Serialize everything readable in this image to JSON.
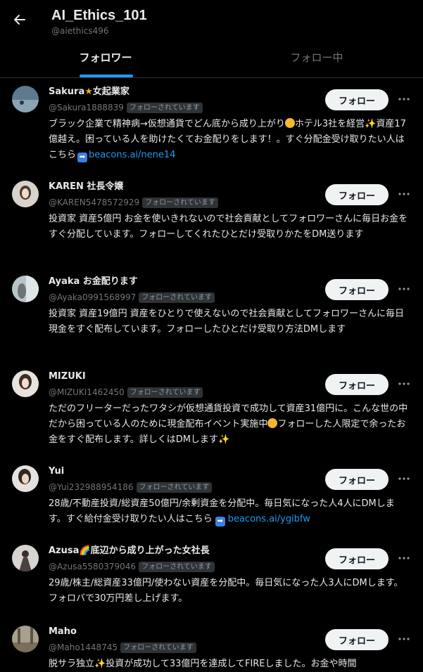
{
  "header": {
    "title": "AI_Ethics_101",
    "handle": "@aiethics496"
  },
  "tabs": [
    {
      "label": "フォロワー",
      "active": true
    },
    {
      "label": "フォロー中",
      "active": false
    }
  ],
  "follow_button_label": "フォロー",
  "followed_badge": "フォローされています",
  "users": [
    {
      "name": "Sakura",
      "name_suffix": "女起業家",
      "handle": "@Sakura1888839",
      "follows_you": true,
      "bio_parts": [
        "ブラック企業で精神病→仮想通貨でどん底から成り上がり",
        "ホテル3社を経営",
        "資産17億越え。困っている人を助けたくてお金配りをします！。すぐ分配金受け取りたい人はこちら"
      ],
      "link": "beacons.ai/nene14"
    },
    {
      "name": "KAREN 社長令嬢",
      "handle": "@KAREN5478572929",
      "follows_you": true,
      "bio": "投資家 資産5億円 お金を使いきれないので社会貢献としてフォロワーさんに毎日お金をすぐ分配しています。フォローしてくれたひとだけ受取りかたをDM送ります"
    },
    {
      "name": "Ayaka お金配ります",
      "handle": "@Ayaka0991568997",
      "follows_you": true,
      "bio": "投資家 資産19億円 資産をひとりで使えないので社会貢献としてフォロワーさんに毎日現金をすぐ配布しています。フォローしたひとだけ受取り方法DMします"
    },
    {
      "name": "MIZUKI",
      "handle": "@MIZUKI1462450",
      "follows_you": true,
      "bio_parts": [
        "ただのフリーターだったワタシが仮想通貨投資で成功して資産31億円に。こんな世の中だから困っている人のために現金配布イベント実施中",
        "フォローした人限定で余ったお金をすぐ配布します。詳しくはDMします"
      ]
    },
    {
      "name": "Yui",
      "handle": "@Yui232988954186",
      "follows_you": true,
      "bio": "28歳/不動産投資/総資産50億円/余剰資金を分配中。毎日気になった人4人にDMします。すぐ給付金受け取りたい人はこちら",
      "link": "beacons.ai/ygibfw"
    },
    {
      "name": "Azusa",
      "name_suffix": "底辺から成り上がった女社長",
      "handle": "@Azusa5580379046",
      "follows_you": true,
      "bio": "29歳/株主/総資産33億円/使わない資産を分配中。毎日気になった人3人にDMします。フォロバで30万円差し上げます。"
    },
    {
      "name": "Maho",
      "handle": "@Maho1448745",
      "follows_you": true,
      "bio_parts": [
        "脱サラ独立",
        "投資が成功して33億円を達成してFIREしました。お金や時間"
      ]
    }
  ],
  "icons": {
    "back": "arrow-left-icon",
    "more": "more-horizontal-icon"
  },
  "colors": {
    "accent": "#1d9bf0",
    "background": "#000000",
    "button_bg": "#eff3f4"
  }
}
